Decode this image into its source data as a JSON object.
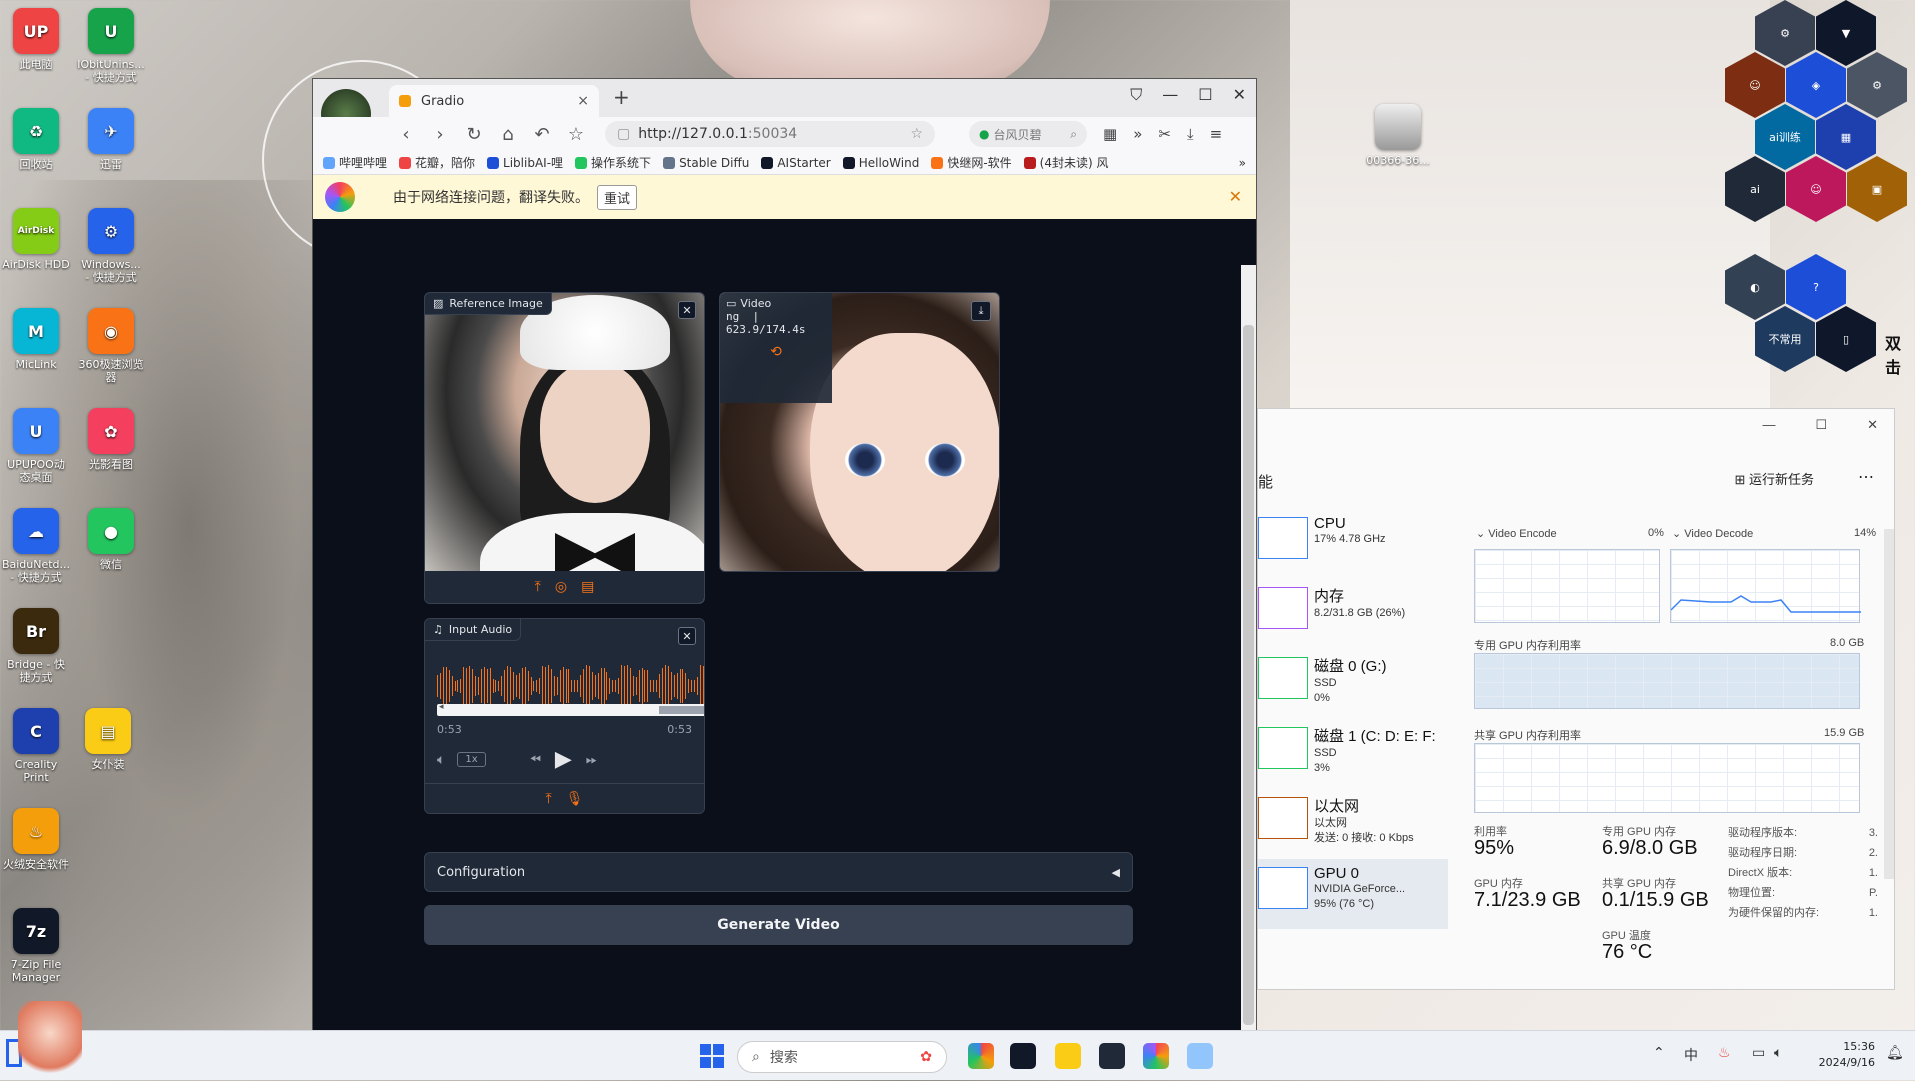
{
  "desktop": {
    "icons": [
      {
        "label": "此电脑",
        "color": "#ef4444",
        "glyph": "UP"
      },
      {
        "label": "IObitUnins...\n- 快捷方式",
        "color": "#16a34a",
        "glyph": "U"
      },
      {
        "label": "回收站",
        "color": "#10b981",
        "glyph": "♻"
      },
      {
        "label": "迅雷",
        "color": "#3b82f6",
        "glyph": "✈"
      },
      {
        "label": "AirDisk HDD",
        "color": "#84cc16",
        "glyph": "AirDisk"
      },
      {
        "label": "Windows...\n- 快捷方式",
        "color": "#2563eb",
        "glyph": "⚙"
      },
      {
        "label": "MicLink",
        "color": "#06b6d4",
        "glyph": "M"
      },
      {
        "label": "360极速浏览\n器",
        "color": "#f97316",
        "glyph": "◉"
      },
      {
        "label": "UPUPOO动\n态桌面",
        "color": "#3b82f6",
        "glyph": "U"
      },
      {
        "label": "光影看图",
        "color": "#f43f5e",
        "glyph": "✿"
      },
      {
        "label": "BaiduNetd...\n- 快捷方式",
        "color": "#2563eb",
        "glyph": "☁"
      },
      {
        "label": "微信",
        "color": "#22c55e",
        "glyph": "●"
      },
      {
        "label": "Bridge - 快\n捷方式",
        "color": "#3b2a0e",
        "glyph": "Br"
      },
      {
        "label": "Creality\nPrint",
        "color": "#1e40af",
        "glyph": "C"
      },
      {
        "label": "女仆装",
        "color": "#facc15",
        "glyph": "▤"
      },
      {
        "label": "火绒安全软件",
        "color": "#f59e0b",
        "glyph": "♨"
      },
      {
        "label": "7-Zip File\nManager",
        "color": "#111827",
        "glyph": "7z"
      }
    ],
    "photo_label": "00366-36...",
    "widget_labels": {
      "ai_train": "ai训练",
      "rare": "不常用",
      "dbl": "双击"
    }
  },
  "browser": {
    "tab_title": "Gradio",
    "url_host": "http://127.0.0.1",
    "url_port": ":50034",
    "search_placeholder": "台风贝碧",
    "bookmarks": [
      "哔哩哔哩",
      "花瓣，陪你",
      "LiblibAI-哩",
      "操作系统下",
      "Stable Diffu",
      "AIStarter",
      "HelloWind",
      "快继网-软件",
      "(4封未读) 风"
    ],
    "infobar_text": "由于网络连接问题，翻译失败。",
    "infobar_retry": "重试"
  },
  "gradio": {
    "reference_label": "Reference Image",
    "video_label": "Video",
    "video_progress": "ng  |\n623.9/174.4s",
    "audio_label": "Input Audio",
    "audio_time_current": "0:53",
    "audio_time_total": "0:53",
    "audio_speed": "1x",
    "config_label": "Configuration",
    "generate_label": "Generate Video"
  },
  "taskmgr": {
    "section_title": "能",
    "run_task": "运行新任务",
    "items": [
      {
        "name": "CPU",
        "sub1": "17% 4.78 GHz",
        "sub2": ""
      },
      {
        "name": "内存",
        "sub1": "8.2/31.8 GB (26%)",
        "sub2": ""
      },
      {
        "name": "磁盘 0 (G:)",
        "sub1": "SSD",
        "sub2": "0%"
      },
      {
        "name": "磁盘 1 (C: D: E: F:",
        "sub1": "SSD",
        "sub2": "3%"
      },
      {
        "name": "以太网",
        "sub1": "以太网",
        "sub2": "发送: 0 接收: 0 Kbps"
      },
      {
        "name": "GPU 0",
        "sub1": "NVIDIA GeForce...",
        "sub2": "95% (76 °C)"
      }
    ],
    "video_encode": "Video Encode",
    "video_encode_pct": "0%",
    "video_decode": "Video Decode",
    "video_decode_pct": "14%",
    "dedicated_label": "专用 GPU 内存利用率",
    "dedicated_max": "8.0 GB",
    "shared_label": "共享 GPU 内存利用率",
    "shared_max": "15.9 GB",
    "stats": {
      "util_label": "利用率",
      "util": "95%",
      "ded_label": "专用 GPU 内存",
      "ded": "6.9/8.0 GB",
      "gpumem_label": "GPU 内存",
      "gpumem": "7.1/23.9 GB",
      "shared_label": "共享 GPU 内存",
      "shared": "0.1/15.9 GB",
      "temp_label": "GPU 温度",
      "temp": "76 °C"
    },
    "driver": [
      {
        "k": "驱动程序版本:",
        "v": "3."
      },
      {
        "k": "驱动程序日期:",
        "v": "2."
      },
      {
        "k": "DirectX 版本:",
        "v": "1."
      },
      {
        "k": "物理位置:",
        "v": "P."
      },
      {
        "k": "为硬件保留的内存:",
        "v": "1."
      }
    ]
  },
  "taskbar": {
    "search_placeholder": "搜索",
    "time": "15:36",
    "date": "2024/9/16",
    "ime": "中"
  }
}
